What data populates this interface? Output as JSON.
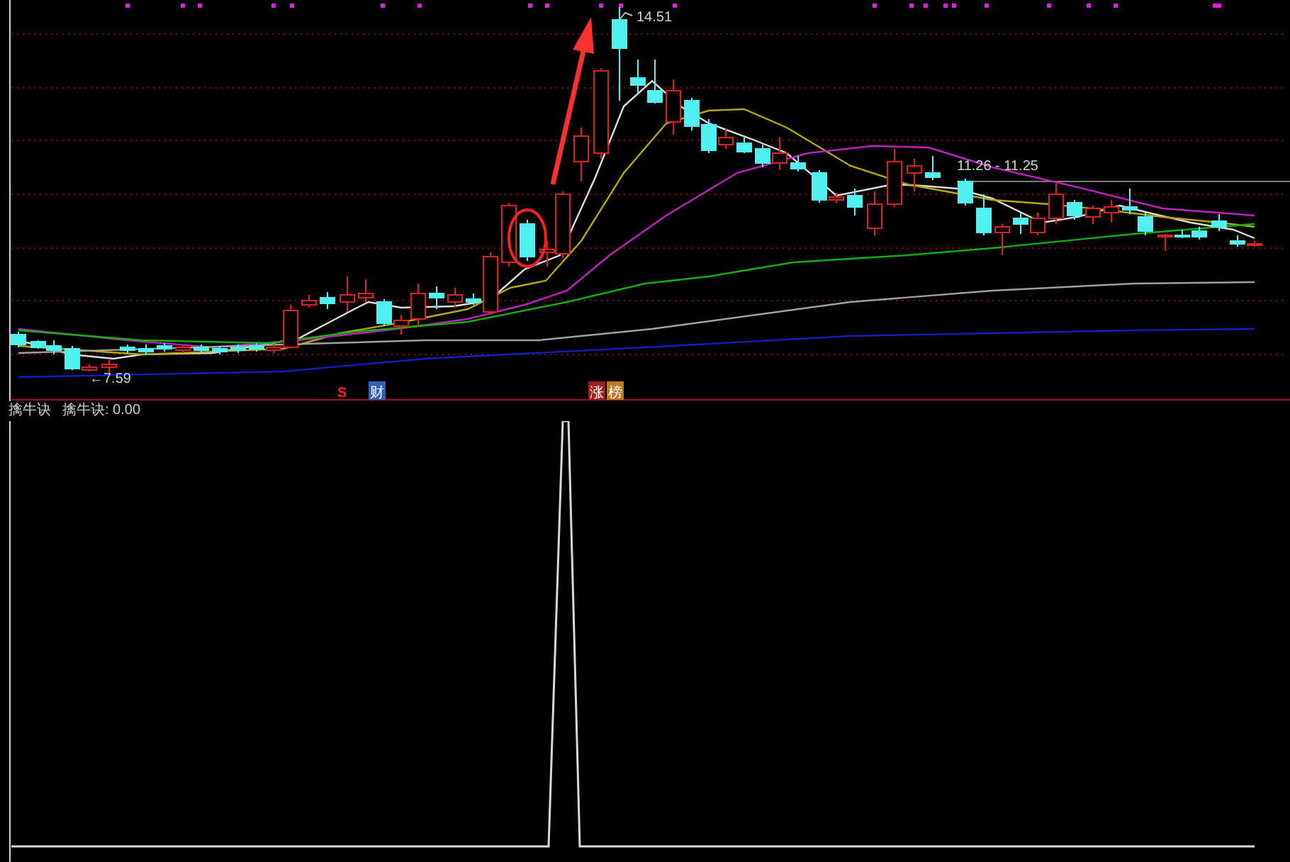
{
  "price_panel": {
    "high_label": "14.51",
    "low_label": "←7.59",
    "range_label": "11.26 - 11.25",
    "event_markers": [
      {
        "text": "S",
        "kind": "plain",
        "color": "#ff2020"
      },
      {
        "text": "财",
        "kind": "boxed",
        "color": "#2f5fb8"
      },
      {
        "text": "涨",
        "kind": "boxed",
        "color": "#a02020"
      },
      {
        "text": "榜",
        "kind": "boxed",
        "color": "#c07820"
      }
    ]
  },
  "indicator_panel": {
    "name": "擒牛诀",
    "value_label": "擒牛诀: 0.00"
  }
}
